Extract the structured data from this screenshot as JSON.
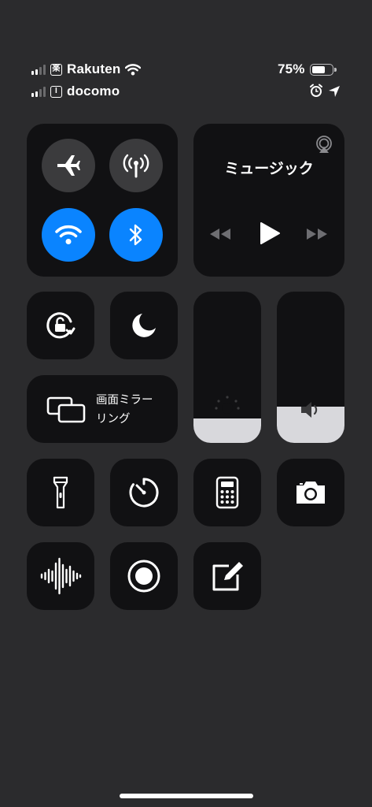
{
  "status_bar": {
    "carrier_primary": "Rakuten",
    "carrier_primary_sim_glyph": "楽",
    "carrier_secondary": "docomo",
    "carrier_secondary_sim_glyph": "I",
    "battery_percent_text": "75%",
    "battery_level": 0.75,
    "icons": [
      "cellular-signal-icon",
      "wifi-icon",
      "battery-icon",
      "alarm-icon",
      "location-arrow-icon"
    ]
  },
  "connectivity": {
    "airplane_mode": false,
    "cellular_data": false,
    "wifi": true,
    "bluetooth": true
  },
  "music": {
    "title": "ミュージック",
    "icons": [
      "airplay-icon",
      "rewind-icon",
      "play-icon",
      "fast-forward-icon"
    ]
  },
  "controls": {
    "rotation_lock_icon": "rotation-lock-icon",
    "do_not_disturb_icon": "moon-icon",
    "screen_mirroring_label_line1": "画面ミラー",
    "screen_mirroring_label_line2": "リング"
  },
  "sliders": {
    "brightness_level": 0.16,
    "volume_level": 0.24
  },
  "shortcuts": [
    "flashlight-icon",
    "timer-icon",
    "calculator-icon",
    "camera-icon",
    "voice-memo-icon",
    "screen-record-icon",
    "notes-icon"
  ],
  "colors": {
    "background": "#2b2b2d",
    "tile": "#111113",
    "button_off": "#3b3b3d",
    "accent_blue": "#0a84ff",
    "slider_fill": "#d8d8dc"
  }
}
